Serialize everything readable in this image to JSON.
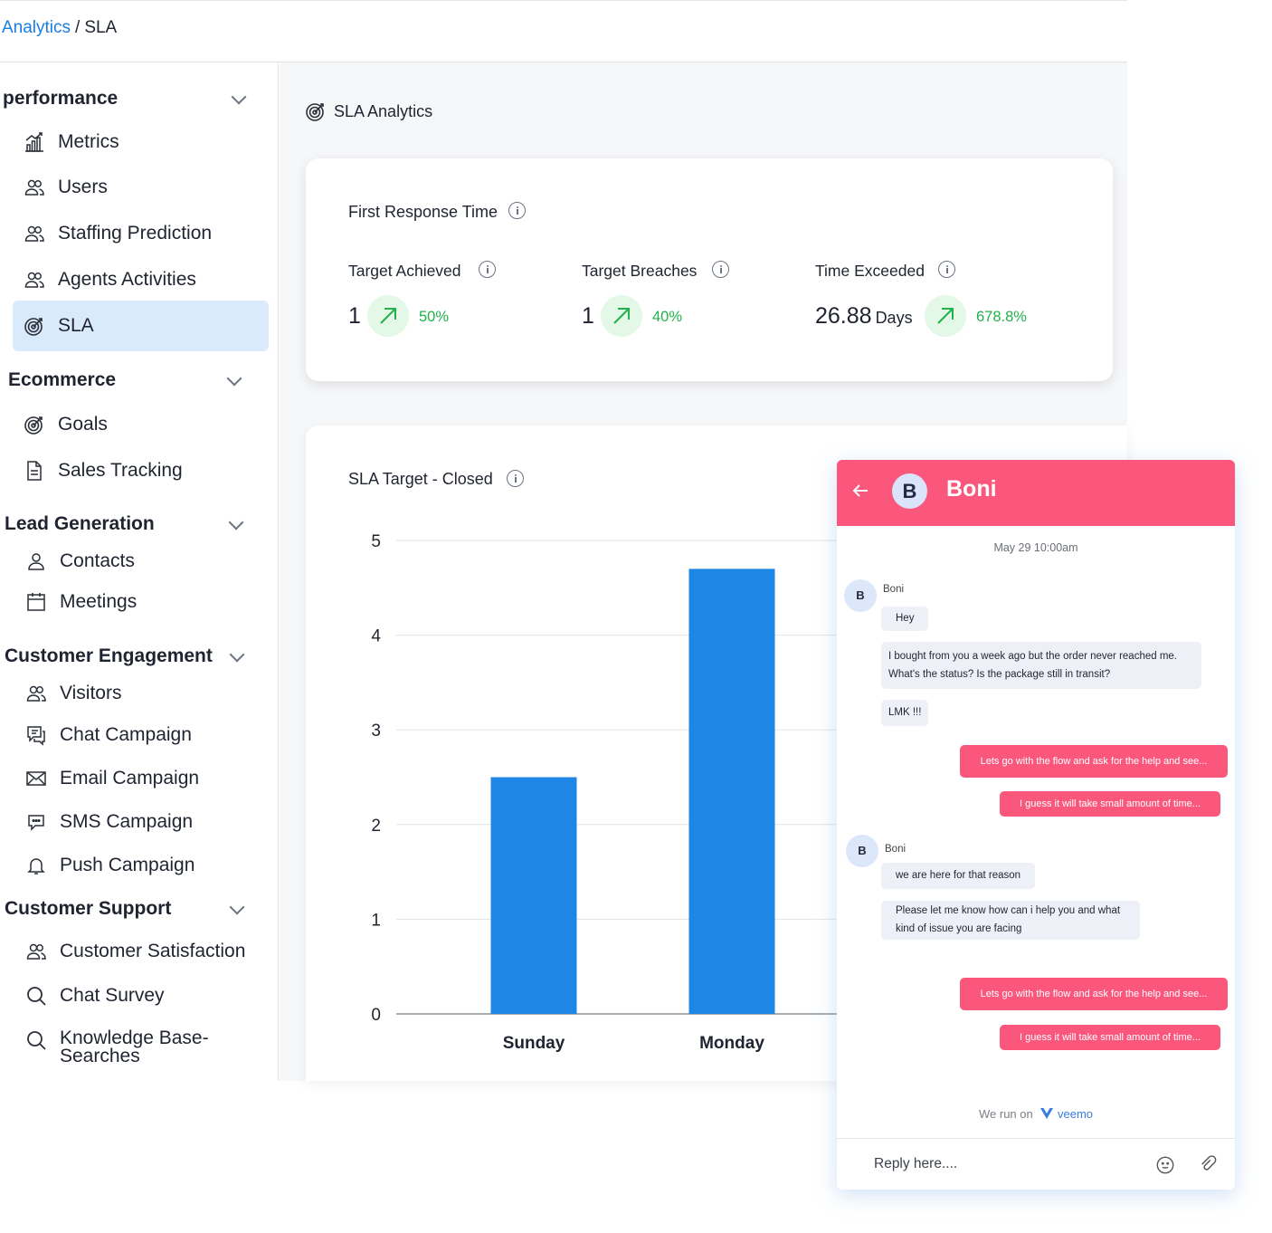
{
  "breadcrumb": {
    "parent": "Analytics",
    "separator": "/",
    "current": "SLA"
  },
  "sidebar": {
    "sections": [
      {
        "title": "performance",
        "items": [
          {
            "label": "Metrics",
            "icon": "chart-growth-icon"
          },
          {
            "label": "Users",
            "icon": "users-icon"
          },
          {
            "label": "Staffing Prediction",
            "icon": "users-icon"
          },
          {
            "label": "Agents Activities",
            "icon": "users-icon"
          },
          {
            "label": "SLA",
            "icon": "target-icon",
            "active": true
          }
        ]
      },
      {
        "title": "Ecommerce",
        "items": [
          {
            "label": "Goals",
            "icon": "target-icon"
          },
          {
            "label": "Sales Tracking",
            "icon": "document-icon"
          }
        ]
      },
      {
        "title": "Lead Generation",
        "items": [
          {
            "label": "Contacts",
            "icon": "user-icon"
          },
          {
            "label": "Meetings",
            "icon": "calendar-icon"
          }
        ]
      },
      {
        "title": "Customer Engagement",
        "items": [
          {
            "label": "Visitors",
            "icon": "users-icon"
          },
          {
            "label": "Chat Campaign",
            "icon": "chat-icon"
          },
          {
            "label": "Email Campaign",
            "icon": "email-icon"
          },
          {
            "label": "SMS Campaign",
            "icon": "sms-icon"
          },
          {
            "label": "Push Campaign",
            "icon": "bell-icon"
          }
        ]
      },
      {
        "title": "Customer Support",
        "items": [
          {
            "label": "Customer Satisfaction",
            "icon": "users-icon"
          },
          {
            "label": "Chat Survey",
            "icon": "search-icon"
          },
          {
            "label": "Knowledge Base- Searches",
            "icon": "search-icon"
          }
        ]
      }
    ]
  },
  "main": {
    "title": "SLA Analytics",
    "first_response": {
      "title": "First Response Time",
      "metrics": [
        {
          "label": "Target Achieved",
          "value": "1",
          "unit": "",
          "change": "50%"
        },
        {
          "label": "Target Breaches",
          "value": "1",
          "unit": "",
          "change": "40%"
        },
        {
          "label": "Time Exceeded",
          "value": "26.88",
          "unit": "Days",
          "change": "678.8%"
        }
      ]
    },
    "chart_title": "SLA Target - Closed"
  },
  "chart_data": {
    "type": "bar",
    "title": "SLA Target - Closed",
    "categories": [
      "Sunday",
      "Monday"
    ],
    "values": [
      2.5,
      4.7
    ],
    "ylim": [
      0,
      5
    ],
    "yticks": [
      "0",
      "1",
      "2",
      "3",
      "4",
      "5"
    ],
    "grid": true,
    "bar_color": "#1e86e4"
  },
  "chat": {
    "header_name": "Boni",
    "avatar_letter": "B",
    "timestamp": "May 29 10:00am",
    "messages_group1": {
      "sender": "Boni",
      "incoming": [
        "Hey",
        "I bought from you a week ago but the order never reached me. What's the status? Is the package still in transit?",
        "LMK !!!"
      ],
      "outgoing": [
        "Lets go with the flow and ask for the help and see...",
        "I guess it will take small amount of time..."
      ]
    },
    "messages_group2": {
      "sender": "Boni",
      "incoming": [
        "we are here for that reason",
        "Please let me know how can i help you and what kind of issue you are facing"
      ],
      "outgoing": [
        "Lets go with the flow and ask for the help and see...",
        "I guess it will take small amount of time..."
      ]
    },
    "powered_prefix": "We run on",
    "powered_brand": "veemo",
    "reply_placeholder": "Reply here....",
    "accent": "#fb577d"
  }
}
